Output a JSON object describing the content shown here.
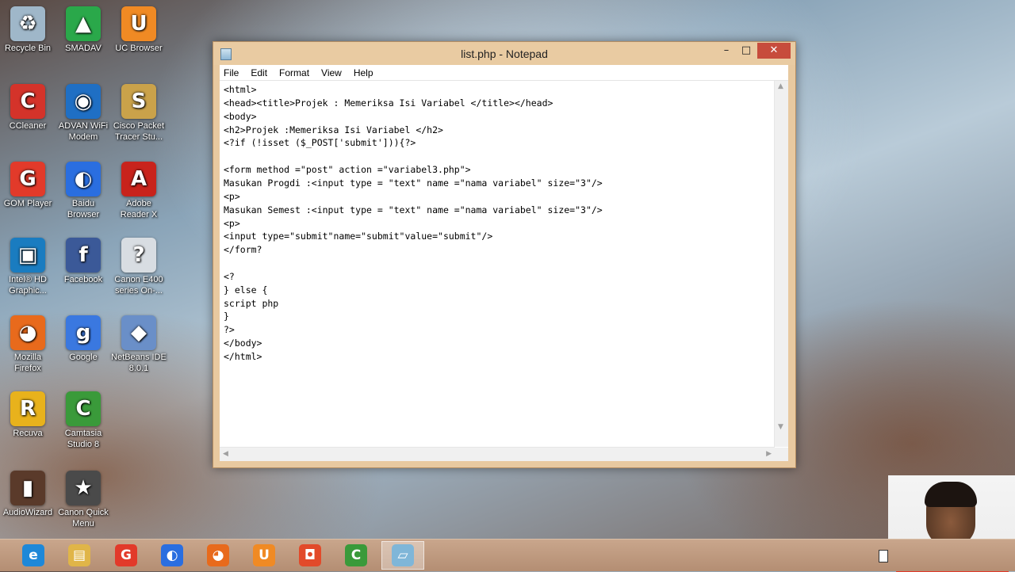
{
  "desktop": {
    "icons": [
      {
        "label": "Recycle Bin",
        "icon": "recycle-bin-icon",
        "color": "#9fb7c9",
        "glyph": "♻"
      },
      {
        "label": "SMADAV",
        "icon": "smadav-icon",
        "color": "#2aa84a",
        "glyph": "▲"
      },
      {
        "label": "UC Browser",
        "icon": "uc-browser-icon",
        "color": "#f08a24",
        "glyph": "U"
      },
      {
        "label": "CCleaner",
        "icon": "ccleaner-icon",
        "color": "#d4332a",
        "glyph": "C"
      },
      {
        "label": "ADVAN WiFi Modem",
        "icon": "advan-wifi-icon",
        "color": "#1f6fc4",
        "glyph": "◉"
      },
      {
        "label": "Cisco Packet Tracer Stu...",
        "icon": "cisco-packet-tracer-icon",
        "color": "#caa24a",
        "glyph": "S"
      },
      {
        "label": "GOM Player",
        "icon": "gom-player-icon",
        "color": "#e23a2a",
        "glyph": "G"
      },
      {
        "label": "Baidu Browser",
        "icon": "baidu-browser-icon",
        "color": "#2a6ee0",
        "glyph": "◐"
      },
      {
        "label": "Adobe Reader X",
        "icon": "adobe-reader-icon",
        "color": "#c8231c",
        "glyph": "A"
      },
      {
        "label": "Intel® HD Graphic...",
        "icon": "intel-hd-graphics-icon",
        "color": "#1a7cc0",
        "glyph": "▣"
      },
      {
        "label": "Facebook",
        "icon": "facebook-icon",
        "color": "#3b5998",
        "glyph": "f"
      },
      {
        "label": "Canon E400 series On-...",
        "icon": "canon-printer-icon",
        "color": "#d8dde2",
        "glyph": "?"
      },
      {
        "label": "Mozilla Firefox",
        "icon": "firefox-icon",
        "color": "#e86a1c",
        "glyph": "◕"
      },
      {
        "label": "Google",
        "icon": "google-icon",
        "color": "#3a78e0",
        "glyph": "g"
      },
      {
        "label": "NetBeans IDE 8.0.1",
        "icon": "netbeans-icon",
        "color": "#6a8fc8",
        "glyph": "◆"
      },
      {
        "label": "Recuva",
        "icon": "recuva-icon",
        "color": "#e8b21c",
        "glyph": "R"
      },
      {
        "label": "Camtasia Studio 8",
        "icon": "camtasia-icon",
        "color": "#3a9a3a",
        "glyph": "C"
      },
      {
        "label": "AudioWizard",
        "icon": "audiowizard-icon",
        "color": "#5a3a2a",
        "glyph": "▮"
      },
      {
        "label": "Canon Quick Menu",
        "icon": "canon-quick-menu-icon",
        "color": "#4a4a4a",
        "glyph": "★"
      }
    ]
  },
  "window": {
    "title": "list.php - Notepad",
    "controls": {
      "minimize": "–",
      "maximize": "□",
      "close": "✕"
    },
    "menu": [
      "File",
      "Edit",
      "Format",
      "View",
      "Help"
    ]
  },
  "editor": {
    "lines": [
      "<html>",
      "<head><title>Projek : Memeriksa Isi Variabel </title></head>",
      "<body>",
      "<h2>Projek :Memeriksa Isi Variabel </h2>",
      "<?if (!isset ($_POST['submit'])){?>",
      "",
      "<form method =\"post\" action =\"variabel3.php\">",
      "Masukan Progdi :<input type = \"text\" name =\"nama variabel\" size=\"3\"/>",
      "<p>",
      "Masukan Semest :<input type = \"text\" name =\"nama variabel\" size=\"3\"/>",
      "<p>",
      "<input type=\"submit\"name=\"submit\"value=\"submit\"/>",
      "</form?",
      "",
      "<?",
      "} else {",
      "script php",
      "}",
      "?>",
      "</body>",
      "</html>"
    ]
  },
  "taskbar": {
    "buttons": [
      {
        "icon": "internet-explorer-icon",
        "color": "#1e88d8",
        "glyph": "e",
        "active": false
      },
      {
        "icon": "file-explorer-icon",
        "color": "#e0b548",
        "glyph": "▤",
        "active": false
      },
      {
        "icon": "gom-player-icon",
        "color": "#e23a2a",
        "glyph": "G",
        "active": false
      },
      {
        "icon": "baidu-browser-icon",
        "color": "#2a6ee0",
        "glyph": "◐",
        "active": false
      },
      {
        "icon": "firefox-icon",
        "color": "#e86a1c",
        "glyph": "◕",
        "active": false
      },
      {
        "icon": "uc-browser-icon",
        "color": "#f08a24",
        "glyph": "U",
        "active": false
      },
      {
        "icon": "camtasia-recorder-icon",
        "color": "#e24a2a",
        "glyph": "◘",
        "active": false
      },
      {
        "icon": "camtasia-studio-icon",
        "color": "#3a9a3a",
        "glyph": "C",
        "active": false
      },
      {
        "icon": "notepad-icon",
        "color": "#7fb6d8",
        "glyph": "▱",
        "active": true
      }
    ]
  }
}
